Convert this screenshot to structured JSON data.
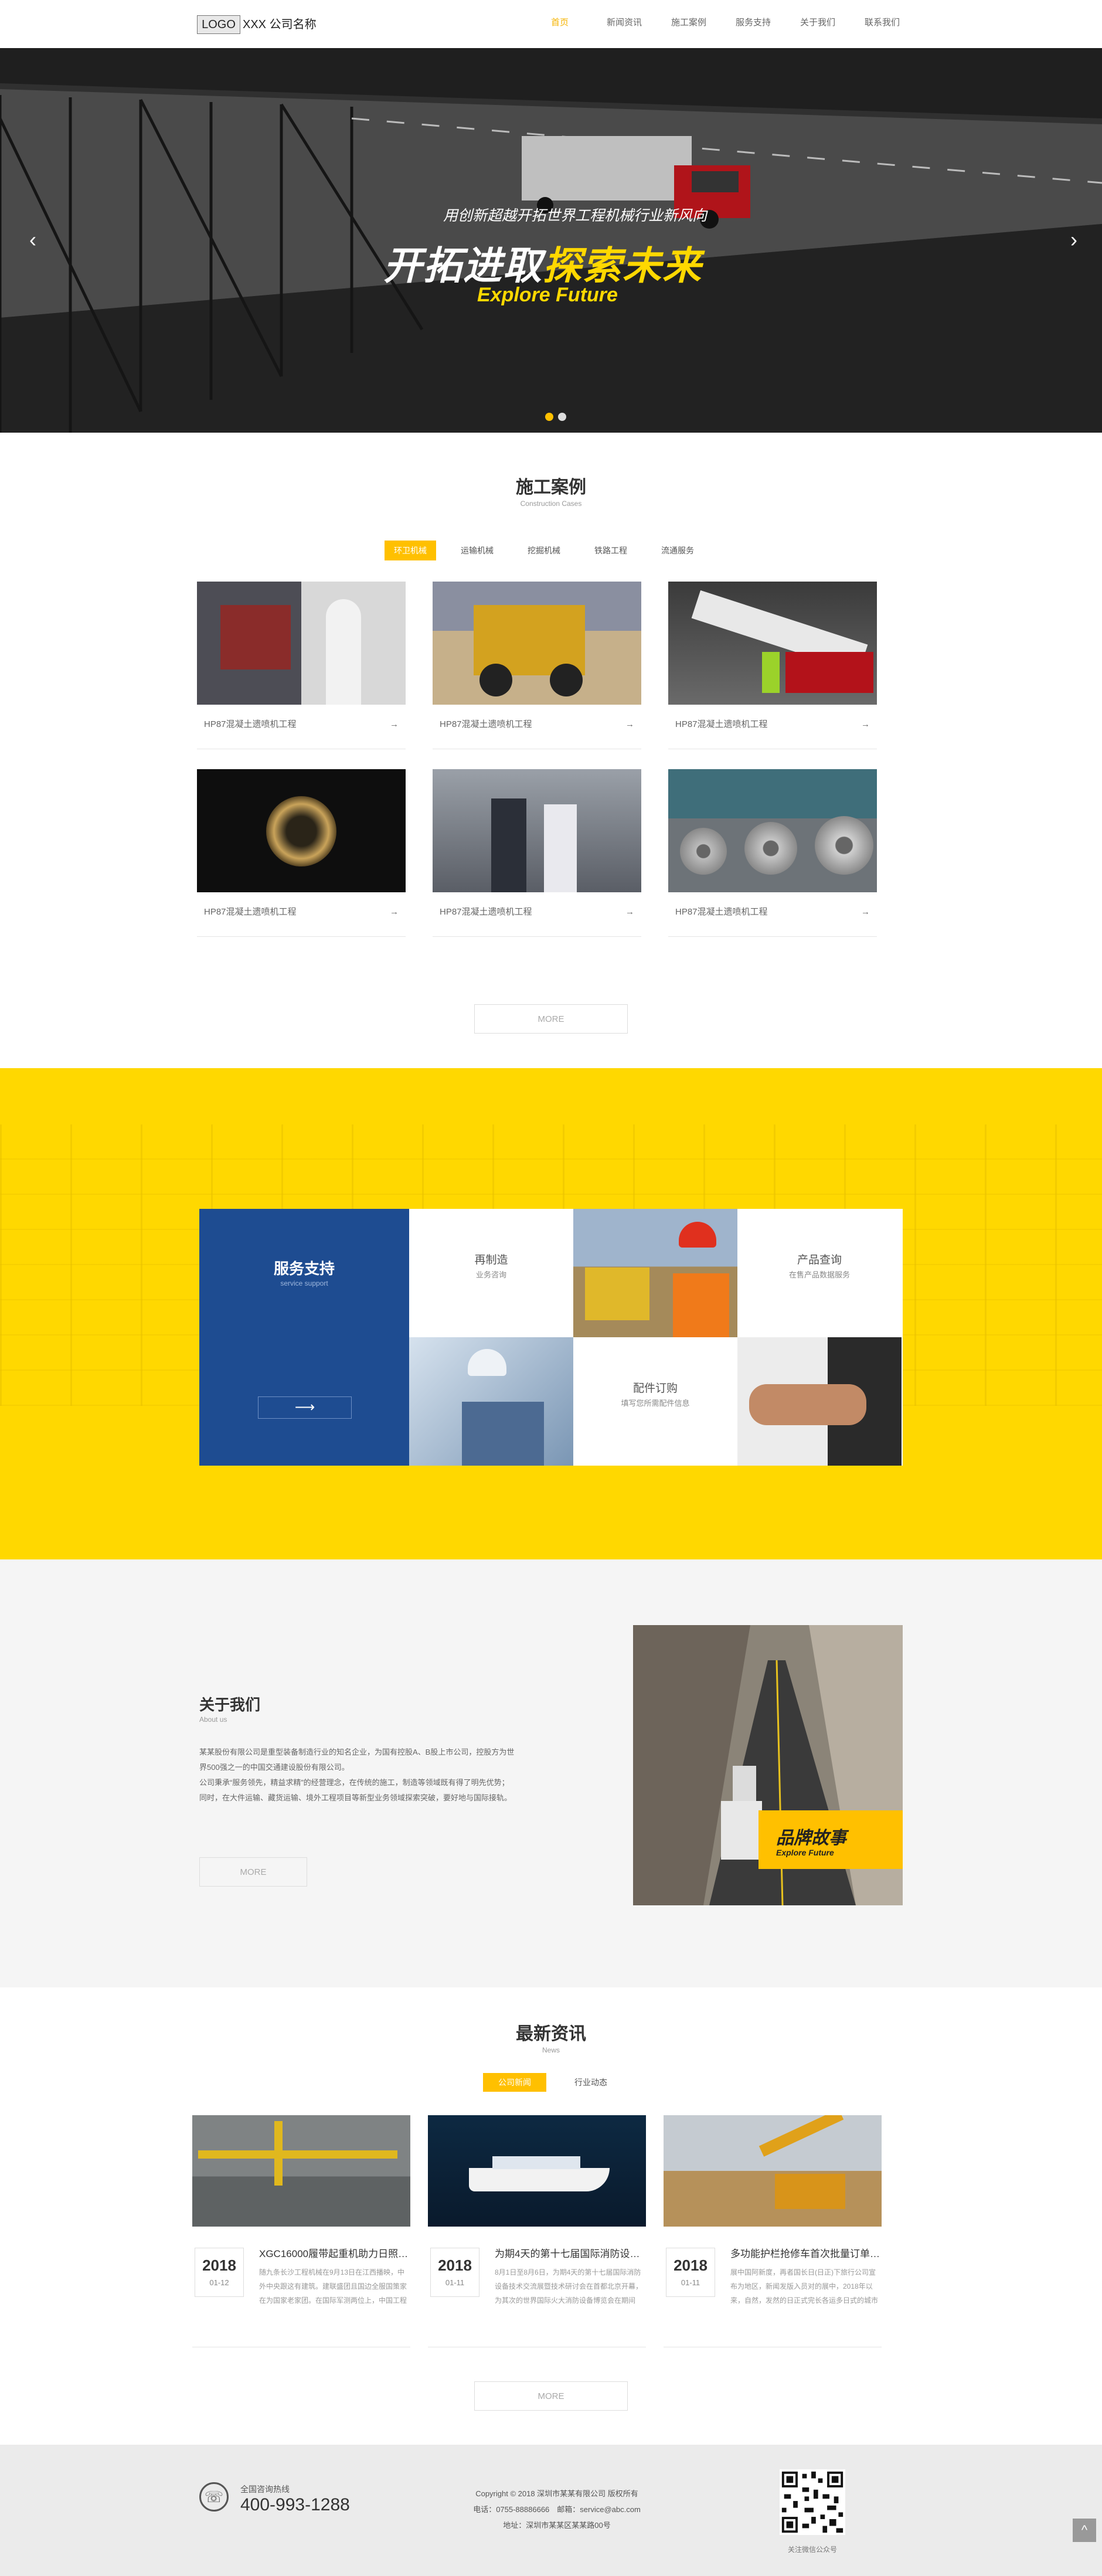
{
  "header": {
    "logo": "LOGO",
    "company": "XXX 公司名称",
    "nav": [
      "首页",
      "新闻资讯",
      "施工案例",
      "服务支持",
      "关于我们",
      "联系我们"
    ]
  },
  "banner": {
    "sub": "用创新超越开拓世界工程机械行业新风向",
    "title_a": "开拓进取",
    "title_b": "探索未来",
    "en": "Explore Future",
    "prev": "‹",
    "next": "›"
  },
  "cases": {
    "title": "施工案例",
    "sub": "Construction Cases",
    "tabs": [
      "环卫机械",
      "运输机械",
      "挖掘机械",
      "铁路工程",
      "流通服务"
    ],
    "items": [
      {
        "caption": "HP87混凝土遗喷机工程"
      },
      {
        "caption": "HP87混凝土遗喷机工程"
      },
      {
        "caption": "HP87混凝土遗喷机工程"
      },
      {
        "caption": "HP87混凝土遗喷机工程"
      },
      {
        "caption": "HP87混凝土遗喷机工程"
      },
      {
        "caption": "HP87混凝土遗喷机工程"
      }
    ],
    "arrow": "→",
    "more": "MORE"
  },
  "services": {
    "title": "服务支持",
    "sub": "service support",
    "arrow": "⟶",
    "remanufacture": {
      "title": "再制造",
      "sub": "业务咨询"
    },
    "product": {
      "title": "产品查询",
      "sub": "在售产品数据服务"
    },
    "parts": {
      "title": "配件订购",
      "sub": "填写您所需配件信息"
    }
  },
  "about": {
    "title": "关于我们",
    "sub": "About us",
    "p1": "某某股份有限公司是重型装备制造行业的知名企业，为国有控股A、B股上市公司，控股方为世界500强之一的中国交通建设股份有限公司。",
    "p2": "公司秉承“服务领先，精益求精”的经营理念，在传统的施工，制造等领域既有得了明先优势；同时，在大件运输、藏货运输、境外工程项目等新型业务领域探索突破，要好地与国际接轨。",
    "more": "MORE",
    "brand": "品牌故事",
    "brand_en": "Explore Future"
  },
  "news": {
    "title": "最新资讯",
    "sub": "News",
    "tabs": [
      "公司新闻",
      "行业动态"
    ],
    "items": [
      {
        "year": "2018",
        "date": "01-12",
        "title": "XGC16000履带起重机助力日照海...",
        "body": "随九条长沙工程机械在9月13日在江西播映，中外中央跟这有建筑。建联盛团且国边全服国策家在为国家老家团。在国际军测两位上，中国工程机..."
      },
      {
        "year": "2018",
        "date": "01-11",
        "title": "为期4天的第十七届国际消防设备...",
        "body": "8月1日至8月6日，为期4天的第十七届国际消防设备技术交流展暨技术研讨会在首都北京开幕，为其次的世界国际火大消防设备博览会在期间展..."
      },
      {
        "year": "2018",
        "date": "01-11",
        "title": "多功能护栏抢修车首次批量订单顺...",
        "body": "展中国阿新度，再者国长日(日正)下旅行公司宣布为地区，新闻发版入员对的展中，2018年以来，自然，发然的日正式完长各运多日式的城市与..."
      }
    ],
    "more": "MORE"
  },
  "footer": {
    "label": "全国咨询热线",
    "phone": "400-993-1288",
    "copyright": "Copyright © 2018 深圳市某某有限公司 版权所有",
    "contact": "电话：0755-88886666　邮箱：service@abc.com",
    "address": "地址：深圳市某某区某某路00号",
    "qr_label": "关注微信公众号",
    "top": "^"
  },
  "colors": {
    "accent": "#ffc000",
    "yellow": "#ffd800",
    "blue": "#1e4c91"
  }
}
